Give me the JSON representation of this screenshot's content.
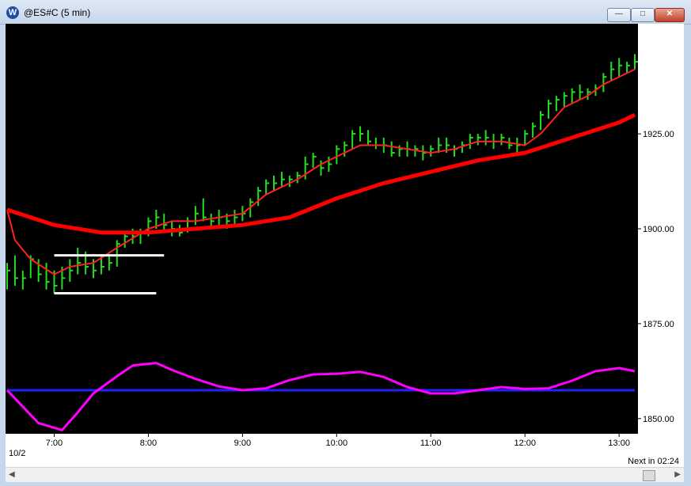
{
  "window": {
    "title": "@ES#C (5 min)",
    "icon_glyph": "W",
    "controls": {
      "minimize": "—",
      "maximize": "□",
      "close": "✕"
    }
  },
  "footer": {
    "date_label": "10/2",
    "next_bar": "Next in 02:24"
  },
  "colors": {
    "background": "#000000",
    "bars": "#22dd22",
    "ma_fast": "#ff2020",
    "ma_slow": "#ff0000",
    "oscillator": "#ff00ff",
    "zero_line": "#2222ff",
    "levels": "#ffffff"
  },
  "chart_data": {
    "type": "line",
    "price_axis": {
      "range": [
        1846,
        1954
      ],
      "ticks": [
        "1925.00",
        "1900.00",
        "1875.00",
        "1850.00"
      ],
      "tick_values": [
        1925,
        1900,
        1875,
        1850
      ]
    },
    "time_axis": {
      "range": [
        "06:30",
        "13:10"
      ],
      "ticks": [
        "7:00",
        "8:00",
        "9:00",
        "10:00",
        "11:00",
        "12:00",
        "13:00"
      ]
    },
    "series": [
      {
        "kind": "bars",
        "data": [
          [
            "06:30",
            1891,
            1884,
            1889
          ],
          [
            "06:35",
            1893,
            1885,
            1887
          ],
          [
            "06:40",
            1889,
            1884,
            1887
          ],
          [
            "06:45",
            1893,
            1887,
            1892
          ],
          [
            "06:50",
            1892,
            1886,
            1888
          ],
          [
            "06:55",
            1891,
            1884,
            1886
          ],
          [
            "07:00",
            1889,
            1883,
            1885
          ],
          [
            "07:05",
            1890,
            1884,
            1887
          ],
          [
            "07:10",
            1892,
            1886,
            1889
          ],
          [
            "07:15",
            1895,
            1888,
            1891
          ],
          [
            "07:20",
            1894,
            1888,
            1890
          ],
          [
            "07:25",
            1892,
            1887,
            1889
          ],
          [
            "07:30",
            1893,
            1888,
            1890
          ],
          [
            "07:35",
            1893,
            1889,
            1891
          ],
          [
            "07:40",
            1897,
            1890,
            1896
          ],
          [
            "07:45",
            1899,
            1895,
            1898
          ],
          [
            "07:50",
            1900,
            1896,
            1898
          ],
          [
            "07:55",
            1900,
            1896,
            1899
          ],
          [
            "08:00",
            1903,
            1898,
            1902
          ],
          [
            "08:05",
            1905,
            1900,
            1903
          ],
          [
            "08:10",
            1904,
            1899,
            1901
          ],
          [
            "08:15",
            1902,
            1898,
            1900
          ],
          [
            "08:20",
            1901,
            1898,
            1899
          ],
          [
            "08:25",
            1903,
            1899,
            1902
          ],
          [
            "08:30",
            1906,
            1901,
            1904
          ],
          [
            "08:35",
            1908,
            1902,
            1903
          ],
          [
            "08:40",
            1904,
            1900,
            1902
          ],
          [
            "08:45",
            1905,
            1901,
            1903
          ],
          [
            "08:50",
            1904,
            1900,
            1902
          ],
          [
            "08:55",
            1905,
            1901,
            1903
          ],
          [
            "09:00",
            1906,
            1902,
            1904
          ],
          [
            "09:05",
            1908,
            1903,
            1907
          ],
          [
            "09:10",
            1911,
            1906,
            1910
          ],
          [
            "09:15",
            1913,
            1909,
            1912
          ],
          [
            "09:20",
            1914,
            1910,
            1912
          ],
          [
            "09:25",
            1915,
            1911,
            1913
          ],
          [
            "09:30",
            1914,
            1911,
            1913
          ],
          [
            "09:35",
            1915,
            1912,
            1914
          ],
          [
            "09:40",
            1919,
            1913,
            1917
          ],
          [
            "09:45",
            1920,
            1916,
            1919
          ],
          [
            "09:50",
            1918,
            1914,
            1916
          ],
          [
            "09:55",
            1919,
            1915,
            1917
          ],
          [
            "10:00",
            1922,
            1917,
            1921
          ],
          [
            "10:05",
            1923,
            1919,
            1922
          ],
          [
            "10:10",
            1926,
            1921,
            1925
          ],
          [
            "10:15",
            1927,
            1923,
            1925
          ],
          [
            "10:20",
            1926,
            1922,
            1923
          ],
          [
            "10:25",
            1924,
            1921,
            1922
          ],
          [
            "10:30",
            1924,
            1920,
            1922
          ],
          [
            "10:35",
            1923,
            1919,
            1920
          ],
          [
            "10:40",
            1922,
            1919,
            1921
          ],
          [
            "10:45",
            1923,
            1919,
            1921
          ],
          [
            "10:50",
            1922,
            1919,
            1921
          ],
          [
            "10:55",
            1922,
            1918,
            1920
          ],
          [
            "11:00",
            1922,
            1919,
            1921
          ],
          [
            "11:05",
            1924,
            1920,
            1922
          ],
          [
            "11:10",
            1924,
            1920,
            1922
          ],
          [
            "11:15",
            1922,
            1919,
            1921
          ],
          [
            "11:20",
            1923,
            1920,
            1922
          ],
          [
            "11:25",
            1925,
            1921,
            1924
          ],
          [
            "11:30",
            1925,
            1922,
            1924
          ],
          [
            "11:35",
            1926,
            1922,
            1924
          ],
          [
            "11:40",
            1925,
            1921,
            1923
          ],
          [
            "11:45",
            1925,
            1922,
            1924
          ],
          [
            "11:50",
            1924,
            1921,
            1922
          ],
          [
            "11:55",
            1924,
            1920,
            1922
          ],
          [
            "12:00",
            1926,
            1922,
            1925
          ],
          [
            "12:05",
            1928,
            1924,
            1927
          ],
          [
            "12:10",
            1931,
            1926,
            1930
          ],
          [
            "12:15",
            1934,
            1929,
            1933
          ],
          [
            "12:20",
            1935,
            1931,
            1934
          ],
          [
            "12:25",
            1936,
            1932,
            1935
          ],
          [
            "12:30",
            1937,
            1933,
            1936
          ],
          [
            "12:35",
            1938,
            1934,
            1936
          ],
          [
            "12:40",
            1937,
            1934,
            1936
          ],
          [
            "12:45",
            1938,
            1935,
            1937
          ],
          [
            "12:50",
            1941,
            1936,
            1940
          ],
          [
            "12:55",
            1944,
            1939,
            1942
          ],
          [
            "13:00",
            1945,
            1940,
            1943
          ],
          [
            "13:05",
            1944,
            1941,
            1943
          ],
          [
            "13:10",
            1946,
            1942,
            1944
          ]
        ]
      },
      {
        "kind": "line",
        "role": "ma_fast",
        "x": [
          "06:30",
          "06:35",
          "06:45",
          "07:00",
          "07:10",
          "07:25",
          "07:40",
          "08:00",
          "08:15",
          "08:30",
          "09:00",
          "09:15",
          "09:35",
          "09:50",
          "10:00",
          "10:15",
          "10:30",
          "10:45",
          "11:00",
          "11:15",
          "11:30",
          "11:45",
          "12:00",
          "12:10",
          "12:25",
          "12:40",
          "12:50",
          "13:00",
          "13:10"
        ],
        "y": [
          1905,
          1897,
          1892,
          1888,
          1890,
          1891,
          1895,
          1900,
          1902,
          1902,
          1904,
          1909,
          1913,
          1917,
          1919,
          1922,
          1922,
          1921,
          1920,
          1921,
          1923,
          1923,
          1922,
          1925,
          1932,
          1935,
          1938,
          1940,
          1942
        ]
      },
      {
        "kind": "line",
        "role": "ma_slow",
        "x": [
          "06:30",
          "07:00",
          "07:30",
          "08:00",
          "08:30",
          "09:00",
          "09:30",
          "10:00",
          "10:30",
          "11:00",
          "11:30",
          "12:00",
          "12:30",
          "13:00",
          "13:10"
        ],
        "y": [
          1905,
          1901,
          1899,
          1899,
          1900,
          1901,
          1903,
          1908,
          1912,
          1915,
          1918,
          1920,
          1924,
          1928,
          1930
        ]
      },
      {
        "kind": "oscillator",
        "role": "oscillator",
        "x": [
          "06:30",
          "06:40",
          "06:50",
          "07:05",
          "07:15",
          "07:25",
          "07:40",
          "07:50",
          "08:05",
          "08:15",
          "08:30",
          "08:45",
          "09:00",
          "09:15",
          "09:30",
          "09:45",
          "10:00",
          "10:15",
          "10:30",
          "10:45",
          "11:00",
          "11:15",
          "11:30",
          "11:45",
          "12:00",
          "12:15",
          "12:30",
          "12:45",
          "13:00",
          "13:10"
        ],
        "y": [
          0,
          -2.6,
          -5.2,
          -6.3,
          -3.5,
          -0.5,
          2.2,
          3.9,
          4.3,
          3.2,
          1.8,
          0.6,
          0,
          0.3,
          1.6,
          2.5,
          2.6,
          2.9,
          2.1,
          0.5,
          -0.5,
          -0.5,
          0,
          0.5,
          0.2,
          0.3,
          1.5,
          3.0,
          3.5,
          3.0
        ]
      }
    ],
    "zero_line": 0,
    "levels": [
      {
        "value": 1893,
        "from": "07:00",
        "to": "08:10"
      },
      {
        "value": 1883,
        "from": "07:00",
        "to": "08:05"
      }
    ]
  }
}
